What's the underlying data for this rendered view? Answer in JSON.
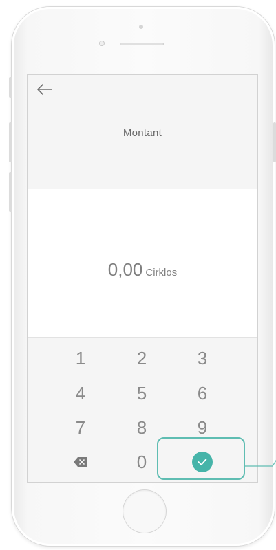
{
  "screen": {
    "title": "Montant",
    "amount": {
      "value": "0,00",
      "unit": "Cirklos"
    }
  },
  "keypad": {
    "keys": [
      "1",
      "2",
      "3",
      "4",
      "5",
      "6",
      "7",
      "8",
      "9",
      "0"
    ]
  },
  "colors": {
    "accent": "#46b4a9",
    "highlight": "#5fbdb2",
    "header_bg": "#f5f5f5"
  },
  "icons": {
    "back": "arrow-left-icon",
    "delete": "backspace-icon",
    "confirm": "check-icon"
  }
}
